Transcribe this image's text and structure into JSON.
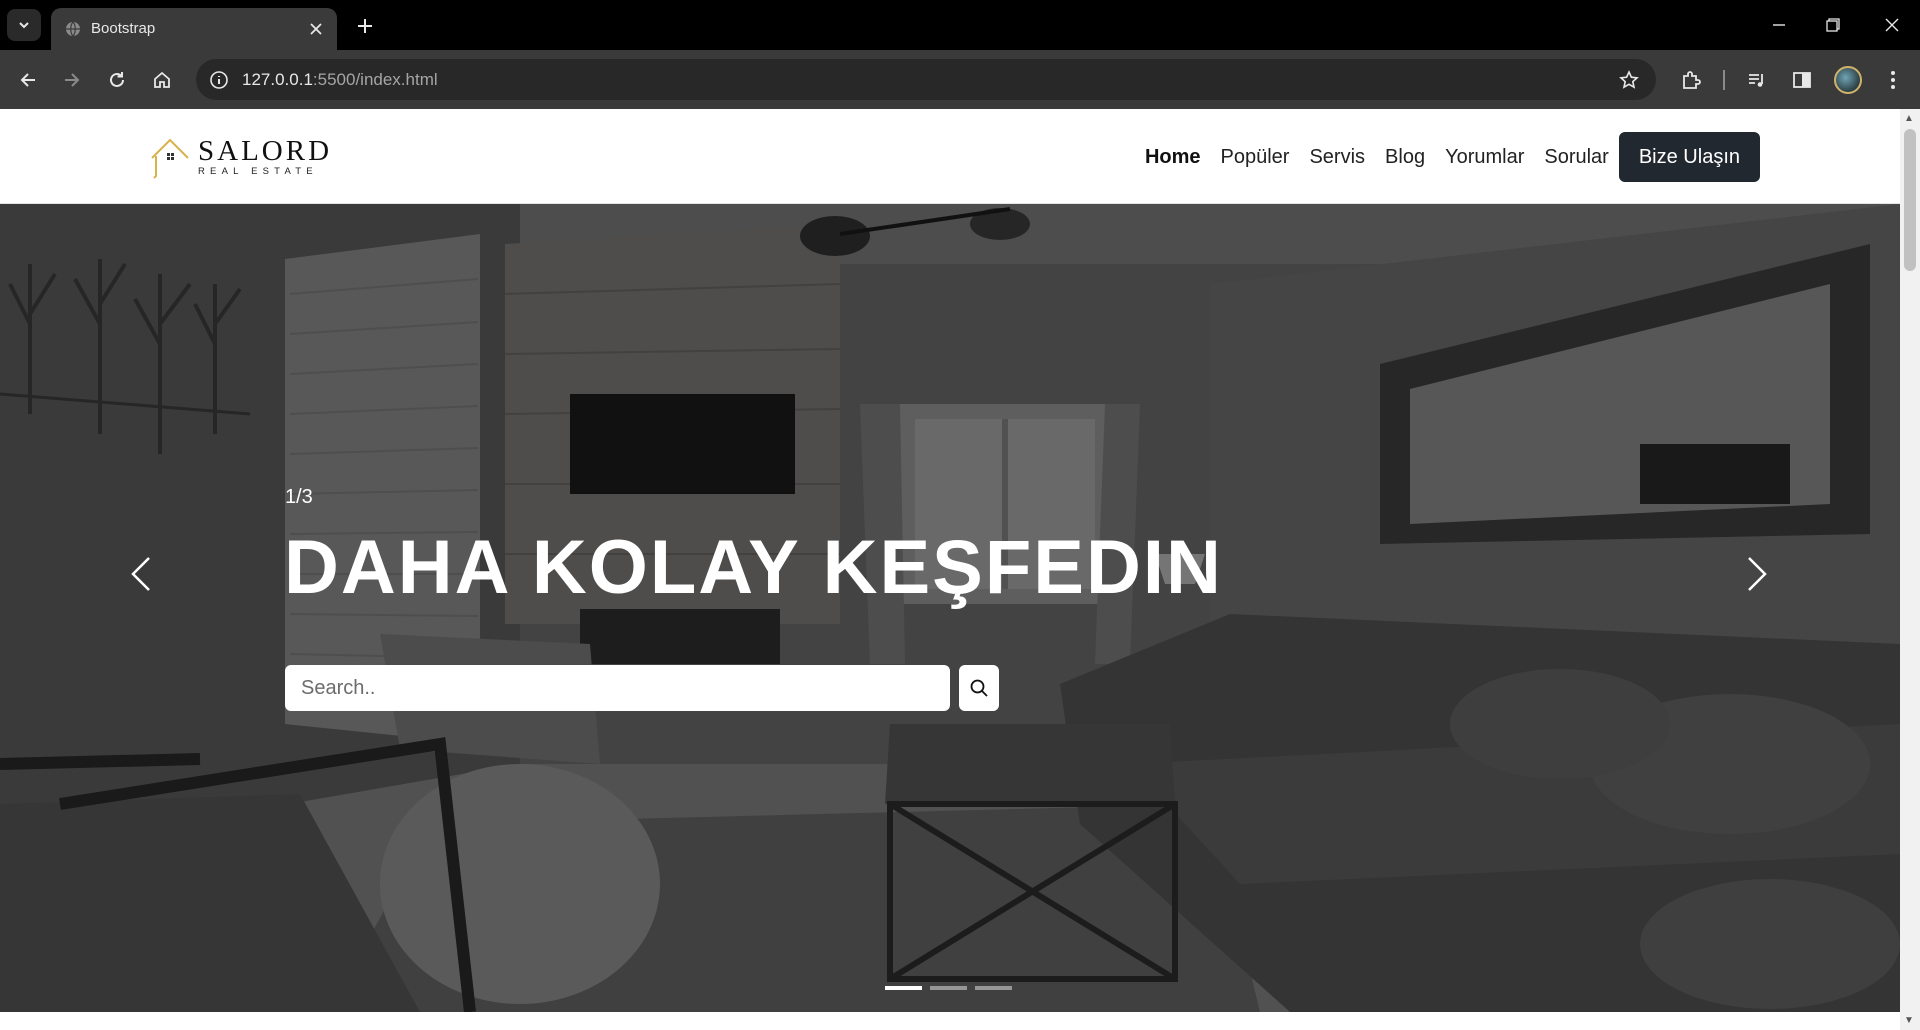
{
  "browser": {
    "tab_title": "Bootstrap",
    "url_host": "127.0.0.1",
    "url_rest": ":5500/index.html"
  },
  "site": {
    "logo_name": "SALORD",
    "logo_sub": "REAL ESTATE",
    "nav": [
      {
        "label": "Home",
        "active": true
      },
      {
        "label": "Popüler"
      },
      {
        "label": "Servis"
      },
      {
        "label": "Blog"
      },
      {
        "label": "Yorumlar"
      },
      {
        "label": "Sorular"
      }
    ],
    "cta": "Bize Ulaşın"
  },
  "hero": {
    "slide_counter": "1/3",
    "headline": "DAHA KOLAY KEŞFEDIN",
    "search_placeholder": "Search..",
    "slides_total": 3,
    "active_slide": 1
  },
  "colors": {
    "cta_bg": "#222830",
    "logo_accent": "#d8b24a"
  }
}
